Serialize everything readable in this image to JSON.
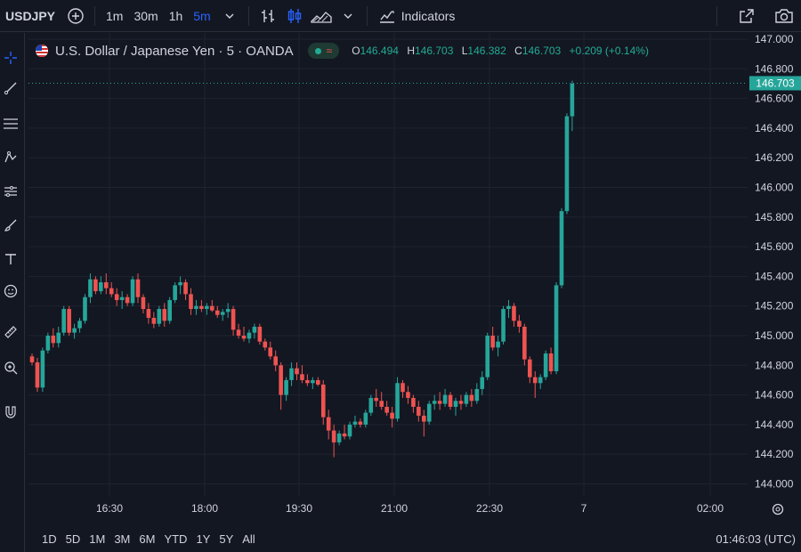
{
  "toolbar": {
    "symbol": "USDJPY",
    "intervals": [
      "1m",
      "30m",
      "1h",
      "5m"
    ],
    "active_interval": "5m",
    "indicators_label": "Indicators"
  },
  "legend": {
    "title": "U.S. Dollar / Japanese Yen · 5 · OANDA",
    "o_label": "O",
    "o": "146.494",
    "h_label": "H",
    "h": "146.703",
    "l_label": "L",
    "l": "146.382",
    "c_label": "C",
    "c": "146.703",
    "change": "+0.209 (+0.14%)"
  },
  "price_axis": {
    "labels": [
      "147.000",
      "146.800",
      "146.600",
      "146.400",
      "146.200",
      "146.000",
      "145.800",
      "145.600",
      "145.400",
      "145.200",
      "145.000",
      "144.800",
      "144.600",
      "144.400",
      "144.200",
      "144.000"
    ],
    "last_price": "146.703"
  },
  "time_axis": {
    "labels": [
      "16:30",
      "18:00",
      "19:30",
      "21:00",
      "22:30",
      "7",
      "02:00"
    ]
  },
  "bottombar": {
    "ranges": [
      "1D",
      "5D",
      "1M",
      "3M",
      "6M",
      "YTD",
      "1Y",
      "5Y",
      "All"
    ],
    "clock": "01:46:03 (UTC)"
  },
  "colors": {
    "up": "#26a69a",
    "down": "#ef5350",
    "background": "#131722",
    "grid": "#1f2330",
    "accent": "#2962ff"
  },
  "chart_data": {
    "type": "candlestick",
    "ylim": [
      144.0,
      147.0
    ],
    "candles": [
      [
        144.86,
        144.88,
        144.8,
        144.82
      ],
      [
        144.82,
        144.85,
        144.62,
        144.65
      ],
      [
        144.65,
        144.92,
        144.62,
        144.9
      ],
      [
        144.9,
        145.02,
        144.88,
        145.0
      ],
      [
        145.0,
        145.05,
        144.92,
        144.95
      ],
      [
        144.95,
        145.06,
        144.92,
        145.02
      ],
      [
        145.02,
        145.2,
        145.0,
        145.18
      ],
      [
        145.18,
        145.2,
        145.0,
        145.02
      ],
      [
        145.02,
        145.08,
        144.98,
        145.05
      ],
      [
        145.05,
        145.12,
        145.02,
        145.1
      ],
      [
        145.1,
        145.28,
        145.08,
        145.26
      ],
      [
        145.26,
        145.42,
        145.22,
        145.38
      ],
      [
        145.38,
        145.4,
        145.28,
        145.3
      ],
      [
        145.3,
        145.4,
        145.28,
        145.36
      ],
      [
        145.36,
        145.42,
        145.28,
        145.32
      ],
      [
        145.32,
        145.36,
        145.26,
        145.28
      ],
      [
        145.28,
        145.32,
        145.2,
        145.24
      ],
      [
        145.24,
        145.3,
        145.18,
        145.26
      ],
      [
        145.26,
        145.28,
        145.2,
        145.22
      ],
      [
        145.22,
        145.4,
        145.2,
        145.38
      ],
      [
        145.38,
        145.42,
        145.22,
        145.26
      ],
      [
        145.26,
        145.28,
        145.15,
        145.18
      ],
      [
        145.18,
        145.22,
        145.08,
        145.12
      ],
      [
        145.12,
        145.16,
        145.05,
        145.08
      ],
      [
        145.08,
        145.2,
        145.06,
        145.18
      ],
      [
        145.18,
        145.22,
        145.06,
        145.1
      ],
      [
        145.1,
        145.26,
        145.08,
        145.24
      ],
      [
        145.24,
        145.36,
        145.22,
        145.34
      ],
      [
        145.34,
        145.4,
        145.28,
        145.36
      ],
      [
        145.36,
        145.38,
        145.24,
        145.28
      ],
      [
        145.28,
        145.32,
        145.14,
        145.18
      ],
      [
        145.18,
        145.24,
        145.14,
        145.2
      ],
      [
        145.2,
        145.24,
        145.16,
        145.18
      ],
      [
        145.18,
        145.22,
        145.14,
        145.2
      ],
      [
        145.2,
        145.24,
        145.16,
        145.17
      ],
      [
        145.17,
        145.2,
        145.12,
        145.14
      ],
      [
        145.14,
        145.18,
        145.1,
        145.16
      ],
      [
        145.16,
        145.22,
        145.12,
        145.18
      ],
      [
        145.18,
        145.2,
        145.0,
        145.04
      ],
      [
        145.04,
        145.08,
        144.98,
        145.0
      ],
      [
        145.0,
        145.06,
        144.96,
        144.98
      ],
      [
        144.98,
        145.04,
        144.95,
        145.02
      ],
      [
        145.02,
        145.08,
        144.98,
        145.06
      ],
      [
        145.06,
        145.08,
        144.94,
        144.96
      ],
      [
        144.96,
        144.98,
        144.9,
        144.92
      ],
      [
        144.92,
        144.96,
        144.84,
        144.86
      ],
      [
        144.86,
        144.9,
        144.76,
        144.8
      ],
      [
        144.8,
        144.82,
        144.5,
        144.6
      ],
      [
        144.6,
        144.72,
        144.56,
        144.7
      ],
      [
        144.7,
        144.82,
        144.66,
        144.78
      ],
      [
        144.78,
        144.82,
        144.7,
        144.74
      ],
      [
        144.74,
        144.8,
        144.68,
        144.7
      ],
      [
        144.7,
        144.74,
        144.66,
        144.68
      ],
      [
        144.68,
        144.72,
        144.64,
        144.7
      ],
      [
        144.7,
        144.72,
        144.66,
        144.67
      ],
      [
        144.67,
        144.7,
        144.4,
        144.45
      ],
      [
        144.45,
        144.5,
        144.3,
        144.36
      ],
      [
        144.36,
        144.4,
        144.18,
        144.28
      ],
      [
        144.28,
        144.36,
        144.26,
        144.34
      ],
      [
        144.34,
        144.4,
        144.3,
        144.32
      ],
      [
        144.32,
        144.42,
        144.3,
        144.4
      ],
      [
        144.4,
        144.46,
        144.38,
        144.42
      ],
      [
        144.42,
        144.44,
        144.38,
        144.4
      ],
      [
        144.4,
        144.5,
        144.38,
        144.48
      ],
      [
        144.48,
        144.6,
        144.46,
        144.58
      ],
      [
        144.58,
        144.64,
        144.52,
        144.56
      ],
      [
        144.56,
        144.62,
        144.5,
        144.52
      ],
      [
        144.52,
        144.56,
        144.46,
        144.48
      ],
      [
        144.48,
        144.52,
        144.38,
        144.44
      ],
      [
        144.44,
        144.72,
        144.42,
        144.68
      ],
      [
        144.68,
        144.7,
        144.58,
        144.62
      ],
      [
        144.62,
        144.66,
        144.54,
        144.58
      ],
      [
        144.58,
        144.6,
        144.48,
        144.52
      ],
      [
        144.52,
        144.56,
        144.42,
        144.46
      ],
      [
        144.46,
        144.5,
        144.32,
        144.42
      ],
      [
        144.42,
        144.56,
        144.4,
        144.54
      ],
      [
        144.54,
        144.6,
        144.5,
        144.56
      ],
      [
        144.56,
        144.62,
        144.5,
        144.54
      ],
      [
        144.54,
        144.64,
        144.52,
        144.6
      ],
      [
        144.6,
        144.62,
        144.5,
        144.52
      ],
      [
        144.52,
        144.58,
        144.46,
        144.56
      ],
      [
        144.56,
        144.6,
        144.5,
        144.54
      ],
      [
        144.54,
        144.62,
        144.52,
        144.6
      ],
      [
        144.6,
        144.64,
        144.52,
        144.56
      ],
      [
        144.56,
        144.68,
        144.54,
        144.64
      ],
      [
        144.64,
        144.76,
        144.6,
        144.72
      ],
      [
        144.72,
        145.02,
        144.7,
        145.0
      ],
      [
        145.0,
        145.06,
        144.9,
        144.92
      ],
      [
        144.92,
        145.0,
        144.86,
        144.96
      ],
      [
        144.96,
        145.2,
        144.94,
        145.18
      ],
      [
        145.18,
        145.24,
        145.12,
        145.2
      ],
      [
        145.2,
        145.22,
        145.06,
        145.1
      ],
      [
        145.1,
        145.14,
        145.02,
        145.06
      ],
      [
        145.06,
        145.08,
        144.8,
        144.84
      ],
      [
        144.84,
        144.86,
        144.68,
        144.72
      ],
      [
        144.72,
        144.76,
        144.58,
        144.68
      ],
      [
        144.68,
        144.74,
        144.64,
        144.72
      ],
      [
        144.72,
        144.9,
        144.7,
        144.88
      ],
      [
        144.88,
        144.92,
        144.74,
        144.76
      ],
      [
        144.76,
        145.36,
        144.74,
        145.34
      ],
      [
        145.34,
        145.86,
        145.32,
        145.84
      ],
      [
        145.84,
        146.5,
        145.82,
        146.48
      ],
      [
        146.48,
        146.72,
        146.38,
        146.7
      ]
    ]
  }
}
